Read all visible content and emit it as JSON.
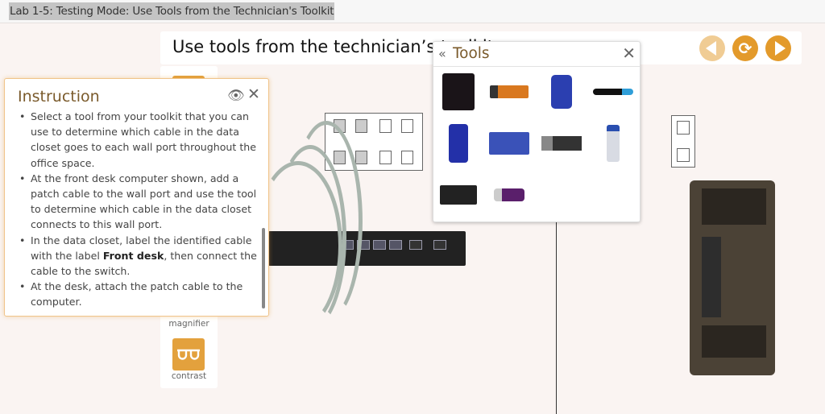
{
  "window": {
    "title": "Lab 1-5: Testing Mode: Use Tools from the Technician's Toolkit"
  },
  "header": {
    "title": "Use tools from the technician’s toolkit"
  },
  "toolbar": {
    "items": [
      {
        "label": "magnifier",
        "icon": "magnifier-icon"
      },
      {
        "label": "contrast",
        "icon": "glasses-icon"
      }
    ]
  },
  "instruction": {
    "title": "Instruction",
    "items": [
      "Select a tool from your toolkit that you can use to determine which cable in the data closet goes to each wall port throughout the office space.",
      "At the front desk computer shown, add a patch cable to the wall port and use the tool to determine which cable in the data closet connects to this wall port.",
      {
        "before": "In the data closet, label the identified cable with the label ",
        "bold": "Front desk",
        "after": ", then connect the cable to the switch."
      },
      "At the desk, attach the patch cable to the computer."
    ]
  },
  "tools_panel": {
    "title": "Tools"
  },
  "colors": {
    "accent": "#e39a2b",
    "heading": "#7a5a2b"
  }
}
